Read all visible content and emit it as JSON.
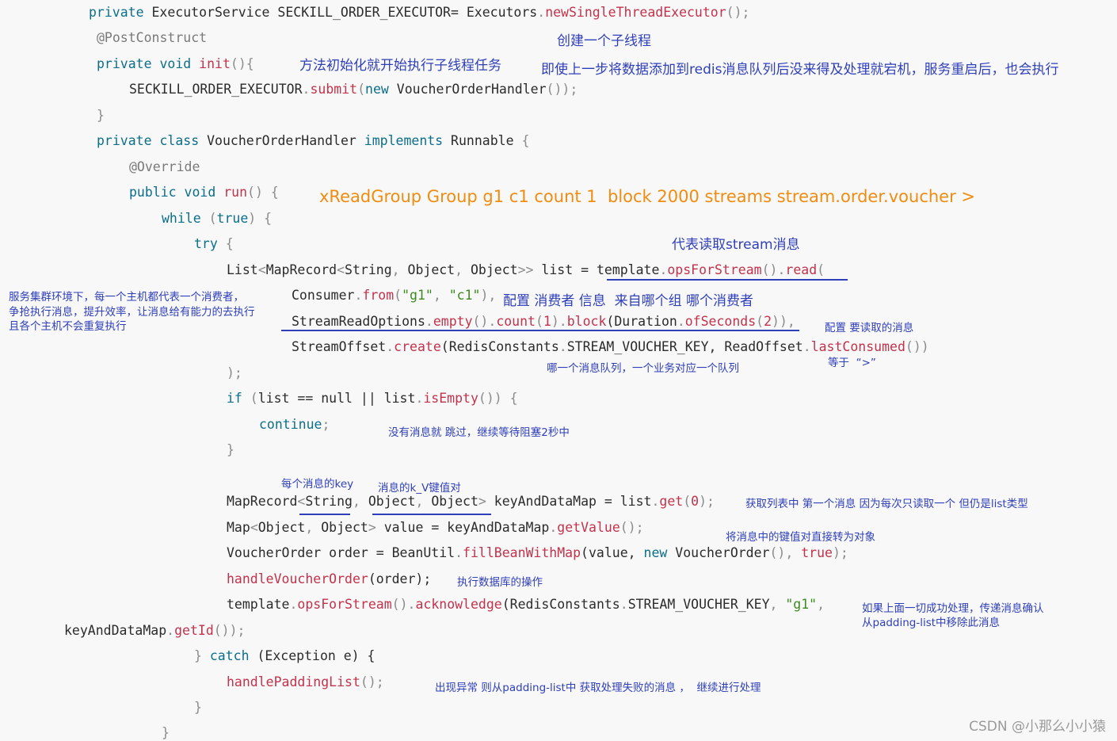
{
  "code": {
    "l1": {
      "a": "private",
      "b": " ExecutorService SECKILL_ORDER_EXECUTOR= Executors",
      "c": ".",
      "d": "newSingleThreadExecutor",
      "e": "();"
    },
    "l2": {
      "a": "@PostConstruct"
    },
    "l3": {
      "a": "private",
      "b": " ",
      "c": "void",
      "d": " ",
      "e": "init",
      "f": "(){"
    },
    "l4": {
      "a": "SECKILL_ORDER_EXECUTOR",
      "b": ".",
      "c": "submit",
      "d": "(",
      "e": "new",
      "f": " VoucherOrderHandler",
      "g": "());"
    },
    "l5": {
      "a": "}"
    },
    "l6": {
      "a": "private",
      "b": " ",
      "c": "class",
      "d": " VoucherOrderHandler ",
      "e": "implements",
      "f": " Runnable ",
      "g": "{"
    },
    "l7": {
      "a": "@Override"
    },
    "l8": {
      "a": "public",
      "b": " ",
      "c": "void",
      "d": " ",
      "e": "run",
      "f": "() {"
    },
    "l9": {
      "a": "while",
      "b": " (",
      "c": "true",
      "d": ") {"
    },
    "l10": {
      "a": "try",
      "b": " {"
    },
    "l11": {
      "a": "List",
      "b": "<",
      "c": "MapRecord",
      "d": "<",
      "e": "String",
      "f": ", ",
      "g": "Object",
      "h": ", ",
      "i": "Object",
      "j": ">> ",
      "k": "list = template",
      "l": ".",
      "m": "opsForStream",
      "n": "().",
      "o": "read",
      "p": "("
    },
    "l12": {
      "a": "Consumer",
      "b": ".",
      "c": "from",
      "d": "(",
      "e": "\"g1\"",
      "f": ", ",
      "g": "\"c1\"",
      "h": "),"
    },
    "l13": {
      "a": "StreamReadOptions",
      "b": ".",
      "c": "empty",
      "d": "().",
      "e": "count",
      "f": "(",
      "g": "1",
      "h": ").",
      "i": "block",
      "j": "(Duration",
      "k": ".",
      "l": "ofSeconds",
      "m": "(",
      "n": "2",
      "o": ")),"
    },
    "l14": {
      "a": "StreamOffset",
      "b": ".",
      "c": "create",
      "d": "(RedisConstants",
      "e": ".",
      "f": "STREAM_VOUCHER_KEY",
      "g": ", ReadOffset",
      "h": ".",
      "i": "lastConsumed",
      "j": "())"
    },
    "l15": {
      "a": ");"
    },
    "l16": {
      "a": "if",
      "b": " (",
      "c": "list == null || list",
      "d": ".",
      "e": "isEmpty",
      "f": "()) {"
    },
    "l17": {
      "a": "continue",
      "b": ";"
    },
    "l18": {
      "a": "}"
    },
    "l19": {
      "a": "MapRecord",
      "b": "<",
      "c": "String",
      "d": ", ",
      "e": "Object",
      "f": ", ",
      "g": "Object",
      "h": "> ",
      "i": "keyAndDataMap = list",
      "j": ".",
      "k": "get",
      "l": "(",
      "m": "0",
      "n": ");"
    },
    "l20": {
      "a": "Map",
      "b": "<",
      "c": "Object",
      "d": ", ",
      "e": "Object",
      "f": "> ",
      "g": "value = keyAndDataMap",
      "h": ".",
      "i": "getValue",
      "j": "();"
    },
    "l21": {
      "a": "VoucherOrder order = BeanUtil",
      "b": ".",
      "c": "fillBeanWithMap",
      "d": "(value, ",
      "e": "new",
      "f": " VoucherOrder",
      "g": "(), ",
      "h": "true",
      "i": ");"
    },
    "l22": {
      "a": "handleVoucherOrder",
      "b": "(order);"
    },
    "l23": {
      "a": "template",
      "b": ".",
      "c": "opsForStream",
      "d": "().",
      "e": "acknowledge",
      "f": "(RedisConstants",
      "g": ".",
      "h": "STREAM_VOUCHER_KEY",
      "i": ", ",
      "j": "\"g1\"",
      "k": ","
    },
    "l24": {
      "a": "keyAndDataMap",
      "b": ".",
      "c": "getId",
      "d": "());"
    },
    "l25": {
      "a": "} ",
      "b": "catch",
      "c": " (Exception e) {"
    },
    "l26": {
      "a": "handlePaddingList",
      "b": "();"
    },
    "l27": {
      "a": "}"
    },
    "l28": {
      "a": "}"
    }
  },
  "notes": {
    "create_thread": "创建一个子线程",
    "init_task": "方法初始化就开始执行子线程任务",
    "restart": "即使上一步将数据添加到redis消息队列后没来得及处理就宕机，服务重启后，也会执行",
    "xreadgroup": "xReadGroup Group g1 c1 count 1  block 2000 streams stream.order.voucher >",
    "read_stream": "代表读取stream消息",
    "cluster_1": "服务集群环境下，每一个主机都代表一个消费者，",
    "cluster_2": "争抢执行消息，提升效率，让消息给有能力的去执行",
    "cluster_3": "且各个主机不会重复执行",
    "consumer_cfg": "配置 消费者 信息  来自哪个组 哪个消费者",
    "read_cfg": "配置 要读取的消息",
    "equals": "等于  “>”",
    "which_queue": "哪一个消息队列，一个业务对应一个队列",
    "no_msg": "没有消息就 跳过，继续等待阻塞2秒中",
    "msg_key": "每个消息的key",
    "kv_pair": "消息的k_V键值对",
    "get_first": "获取列表中 第一个消息 因为每次只读取一个 但仍是list类型",
    "to_object": "将消息中的键值对直接转为对象",
    "db_op": "执行数据库的操作",
    "ack_1": "如果上面一切成功处理，传递消息确认",
    "ack_2": "从padding-list中移除此消息",
    "exception": "出现异常 则从padding-list中 获取处理失败的消息 ，  继续进行处理"
  },
  "colors": {
    "keyword": "#0b6e8a",
    "method": "#c2334b",
    "string": "#3e8a20",
    "annotation_note": "#2f3fb9",
    "highlight_note": "#f08c10",
    "background": "#f8f8f8"
  },
  "watermark": "CSDN @小那么小小猿"
}
